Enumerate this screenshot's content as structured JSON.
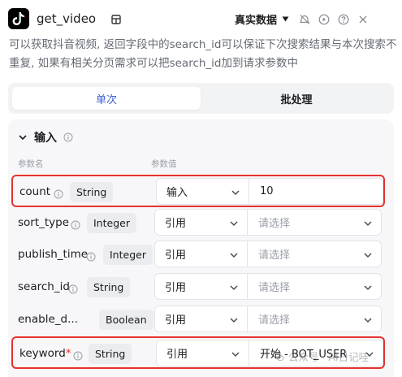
{
  "header": {
    "tool_name": "get_video",
    "mode_label": "真实数据"
  },
  "description": "可以获取抖音视频, 返回字段中的search_id可以保证下次搜索结果与本次搜索不重复, 如果有相关分页需求可以把search_id加到请求参数中",
  "tabs": [
    {
      "label": "单次",
      "active": true
    },
    {
      "label": "批处理",
      "active": false
    }
  ],
  "section": {
    "title": "输入",
    "col_name": "参数名",
    "col_value": "参数值"
  },
  "params": [
    {
      "name": "count",
      "required": false,
      "type": "String",
      "source": "输入",
      "value": "10",
      "is_placeholder": false,
      "has_value_dropdown": false,
      "highlighted": true
    },
    {
      "name": "sort_type",
      "required": false,
      "type": "Integer",
      "source": "引用",
      "value": "请选择",
      "is_placeholder": true,
      "has_value_dropdown": true,
      "highlighted": false
    },
    {
      "name": "publish_time",
      "required": false,
      "type": "Integer",
      "source": "引用",
      "value": "请选择",
      "is_placeholder": true,
      "has_value_dropdown": true,
      "highlighted": false
    },
    {
      "name": "search_id",
      "required": false,
      "type": "String",
      "source": "引用",
      "value": "请选择",
      "is_placeholder": true,
      "has_value_dropdown": true,
      "highlighted": false
    },
    {
      "name": "enable_d...",
      "required": false,
      "type": "Boolean",
      "source": "引用",
      "value": "请选择",
      "is_placeholder": true,
      "has_value_dropdown": true,
      "highlighted": false
    },
    {
      "name": "keyword",
      "required": true,
      "type": "String",
      "source": "引用",
      "value": "开始 - BOT_USER",
      "is_placeholder": false,
      "has_value_dropdown": true,
      "highlighted": true
    }
  ],
  "required_mark": "*",
  "watermark": "公众号 · AI日记哇",
  "colors": {
    "accent": "#3b5bdb",
    "highlight": "#e5322d"
  }
}
